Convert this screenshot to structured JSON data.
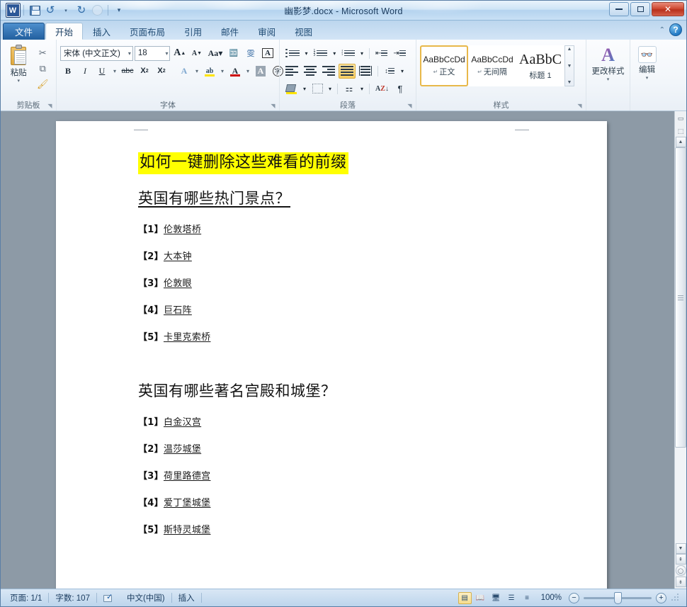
{
  "window": {
    "title": "幽影梦.docx - Microsoft Word",
    "minimize_label": "最小化",
    "restore_label": "还原",
    "close_label": "✕"
  },
  "quick_access": {
    "app_logo": "W",
    "items": [
      {
        "name": "save-icon",
        "label": "保存"
      },
      {
        "name": "undo-icon",
        "label": "撤消"
      },
      {
        "name": "undo-dropdown-icon",
        "label": "▾"
      },
      {
        "name": "redo-icon",
        "label": "恢复"
      },
      {
        "name": "disabled-icon",
        "label": ""
      },
      {
        "name": "customize-qat-icon",
        "label": "▾"
      }
    ]
  },
  "ribbon": {
    "tabs": [
      {
        "id": "file",
        "label": "文件"
      },
      {
        "id": "home",
        "label": "开始"
      },
      {
        "id": "insert",
        "label": "插入"
      },
      {
        "id": "layout",
        "label": "页面布局"
      },
      {
        "id": "references",
        "label": "引用"
      },
      {
        "id": "mailings",
        "label": "邮件"
      },
      {
        "id": "review",
        "label": "审阅"
      },
      {
        "id": "view",
        "label": "视图"
      }
    ],
    "collapse_icon": "⌃",
    "help_icon": "?",
    "groups": {
      "clipboard": {
        "label": "剪贴板",
        "paste_label": "粘贴",
        "paste_caret": "▾",
        "cut_icon": "✂",
        "copy_icon": "⧉",
        "format_painter_icon": "🖌"
      },
      "font": {
        "label": "字体",
        "font_name": "宋体 (中文正文)",
        "font_size": "18",
        "grow_font": "A",
        "shrink_font": "A",
        "change_case": "Aa",
        "clear_format": "A",
        "phonetic": "雯",
        "border_char": "A",
        "bold": "B",
        "italic": "I",
        "underline": "U",
        "strikethrough": "abc",
        "subscript": "X",
        "superscript": "X",
        "text_effects": "A",
        "highlight": "ab",
        "font_color": "A",
        "shading_char": "A",
        "enclose_char": "字",
        "dropdown_caret": "▾"
      },
      "paragraph": {
        "label": "段落",
        "bullets": "•",
        "numbering": "1.",
        "multilevel": "⅓",
        "decrease_indent": "◄",
        "increase_indent": "►",
        "align_left": "左对齐",
        "align_center": "居中",
        "align_right": "右对齐",
        "justify": "两端对齐",
        "distribute": "分散对齐",
        "line_spacing": "行距",
        "shading": "底纹",
        "borders": "边框",
        "show_marks": "¶",
        "sort_a": "A",
        "sort_z": "Z",
        "sort_arrow": "↓",
        "asian_layout": "文"
      },
      "styles": {
        "label": "样式",
        "items": [
          {
            "preview": "AaBbCcDd",
            "mark": "↵",
            "name": "正文",
            "selected": true
          },
          {
            "preview": "AaBbCcDd",
            "mark": "↵",
            "name": "无间隔",
            "selected": false
          },
          {
            "preview": "AaBbC",
            "mark": "",
            "name": "标题 1",
            "selected": false
          }
        ],
        "scroll_up": "▲",
        "scroll_down": "▼",
        "more": "▼"
      },
      "change_styles": {
        "label": "更改样式",
        "icon_text": "A",
        "caret": "▾"
      },
      "editing": {
        "label": "编辑",
        "icon": "🔍",
        "caret": "▾"
      }
    }
  },
  "document": {
    "title": "如何一键删除这些难看的前缀",
    "title_highlight_color": "#ffff00",
    "sections": [
      {
        "heading": "英国有哪些热门景点？",
        "underlined": true,
        "items": [
          {
            "num": "【1】",
            "text": "伦敦塔桥"
          },
          {
            "num": "【2】",
            "text": "大本钟"
          },
          {
            "num": "【3】",
            "text": "伦敦眼"
          },
          {
            "num": "【4】",
            "text": "巨石阵"
          },
          {
            "num": "【5】",
            "text": "卡里克索桥"
          }
        ]
      },
      {
        "heading": "英国有哪些著名宫殿和城堡？",
        "underlined": false,
        "items": [
          {
            "num": "【1】",
            "text": "白金汉宫"
          },
          {
            "num": "【2】",
            "text": "温莎城堡"
          },
          {
            "num": "【3】",
            "text": "荷里路德宫"
          },
          {
            "num": "【4】",
            "text": "爱丁堡城堡"
          },
          {
            "num": "【5】",
            "text": "斯特灵城堡"
          }
        ]
      }
    ]
  },
  "scrollbar": {
    "select_browse_object_icon": "⬚",
    "up_arrow": "▲",
    "down_arrow": "▼",
    "prev_page": "⇞",
    "browse_object": "◯",
    "next_page": "⇟"
  },
  "statusbar": {
    "page": "页面: 1/1",
    "word_count": "字数: 107",
    "language": "中文(中国)",
    "insert_mode": "插入",
    "zoom_level": "100%",
    "zoom_out": "−",
    "zoom_in": "+",
    "views": [
      {
        "name": "print-layout",
        "glyph": "▤",
        "selected": true
      },
      {
        "name": "full-screen-reading",
        "glyph": "📖",
        "selected": false
      },
      {
        "name": "web-layout",
        "glyph": "🖥",
        "selected": false
      },
      {
        "name": "outline",
        "glyph": "☰",
        "selected": false
      },
      {
        "name": "draft",
        "glyph": "≡",
        "selected": false
      }
    ]
  }
}
